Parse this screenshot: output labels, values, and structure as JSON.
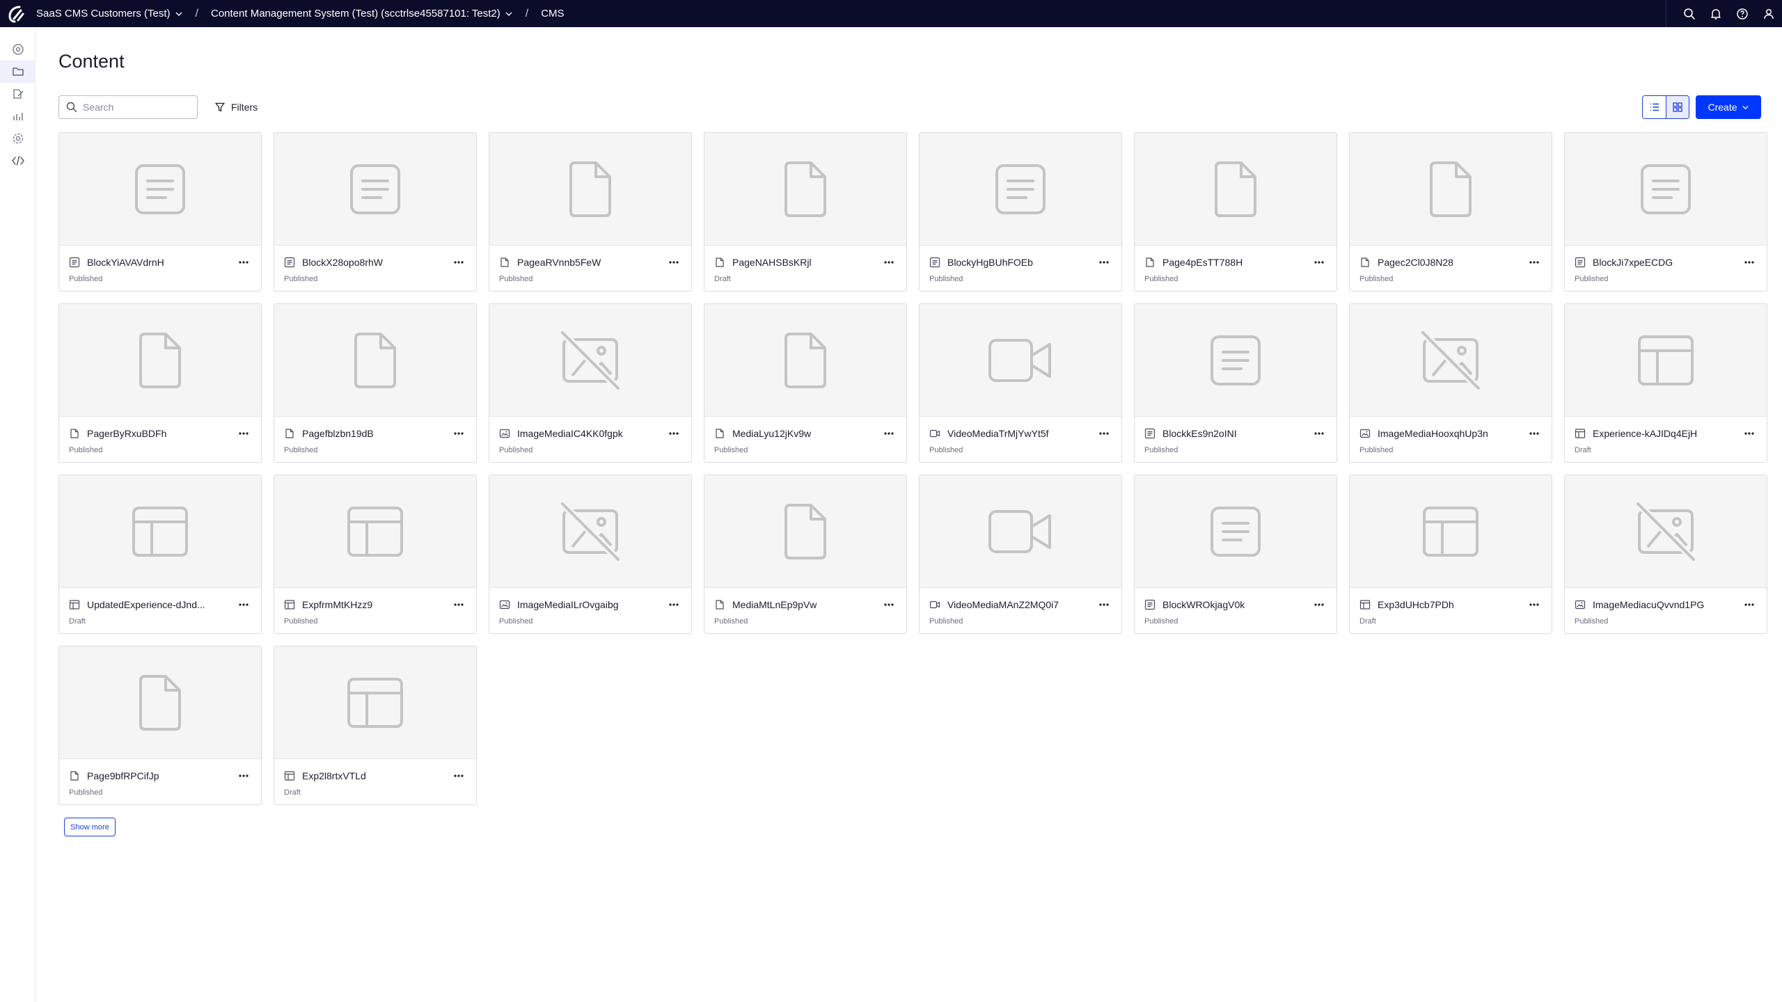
{
  "topbar": {
    "breadcrumbs": [
      {
        "label": "SaaS CMS Customers (Test)",
        "dropdown": true
      },
      {
        "label": "Content Management System (Test) (scctrlse45587101: Test2)",
        "dropdown": true
      },
      {
        "label": "CMS",
        "dropdown": false
      }
    ],
    "icons": [
      "search-icon",
      "bell-icon",
      "help-icon",
      "user-icon"
    ]
  },
  "rail": {
    "items": [
      "home-icon",
      "folder-icon",
      "edit-icon",
      "analytics-icon",
      "settings-icon",
      "code-icon"
    ],
    "active_index": 1
  },
  "page": {
    "title": "Content",
    "search_placeholder": "Search",
    "filters_label": "Filters",
    "create_label": "Create",
    "show_more_label": "Show more"
  },
  "colors": {
    "topbar": "#0b0c2a",
    "primary": "#0037ff",
    "thumb_bg": "#f5f5f5",
    "placeholder_icon": "#c4c4c4"
  },
  "items": [
    {
      "name": "BlockYiAVAVdrnH",
      "status": "Published",
      "type": "block"
    },
    {
      "name": "BlockX28opo8rhW",
      "status": "Published",
      "type": "block"
    },
    {
      "name": "PageaRVnnb5FeW",
      "status": "Published",
      "type": "page"
    },
    {
      "name": "PageNAHSBsKRjl",
      "status": "Draft",
      "type": "page"
    },
    {
      "name": "BlockyHgBUhFOEb",
      "status": "Published",
      "type": "block"
    },
    {
      "name": "Page4pEsTT788H",
      "status": "Published",
      "type": "page"
    },
    {
      "name": "Pagec2Cl0J8N28",
      "status": "Published",
      "type": "page"
    },
    {
      "name": "BlockJi7xpeECDG",
      "status": "Published",
      "type": "block"
    },
    {
      "name": "PagerByRxuBDFh",
      "status": "Published",
      "type": "page"
    },
    {
      "name": "Pagefblzbn19dB",
      "status": "Published",
      "type": "page"
    },
    {
      "name": "ImageMediaIC4KK0fgpk",
      "status": "Published",
      "type": "image"
    },
    {
      "name": "MediaLyu12jKv9w",
      "status": "Published",
      "type": "page"
    },
    {
      "name": "VideoMediaTrMjYwYt5f",
      "status": "Published",
      "type": "video"
    },
    {
      "name": "BlockkEs9n2oINI",
      "status": "Published",
      "type": "block"
    },
    {
      "name": "ImageMediaHooxqhUp3n",
      "status": "Published",
      "type": "image"
    },
    {
      "name": "Experience-kAJIDq4EjH",
      "status": "Draft",
      "type": "experience"
    },
    {
      "name": "UpdatedExperience-dJnd...",
      "status": "Draft",
      "type": "experience"
    },
    {
      "name": "ExpfrmMtKHzz9",
      "status": "Published",
      "type": "experience"
    },
    {
      "name": "ImageMediaILrOvgaibg",
      "status": "Published",
      "type": "image"
    },
    {
      "name": "MediaMtLnEp9pVw",
      "status": "Published",
      "type": "page"
    },
    {
      "name": "VideoMediaMAnZ2MQ0i7",
      "status": "Published",
      "type": "video"
    },
    {
      "name": "BlockWROkjagV0k",
      "status": "Published",
      "type": "block"
    },
    {
      "name": "Exp3dUHcb7PDh",
      "status": "Draft",
      "type": "experience"
    },
    {
      "name": "ImageMediacuQvvnd1PG",
      "status": "Published",
      "type": "image"
    },
    {
      "name": "Page9bfRPCifJp",
      "status": "Published",
      "type": "page"
    },
    {
      "name": "Exp2l8rtxVTLd",
      "status": "Draft",
      "type": "experience"
    }
  ]
}
